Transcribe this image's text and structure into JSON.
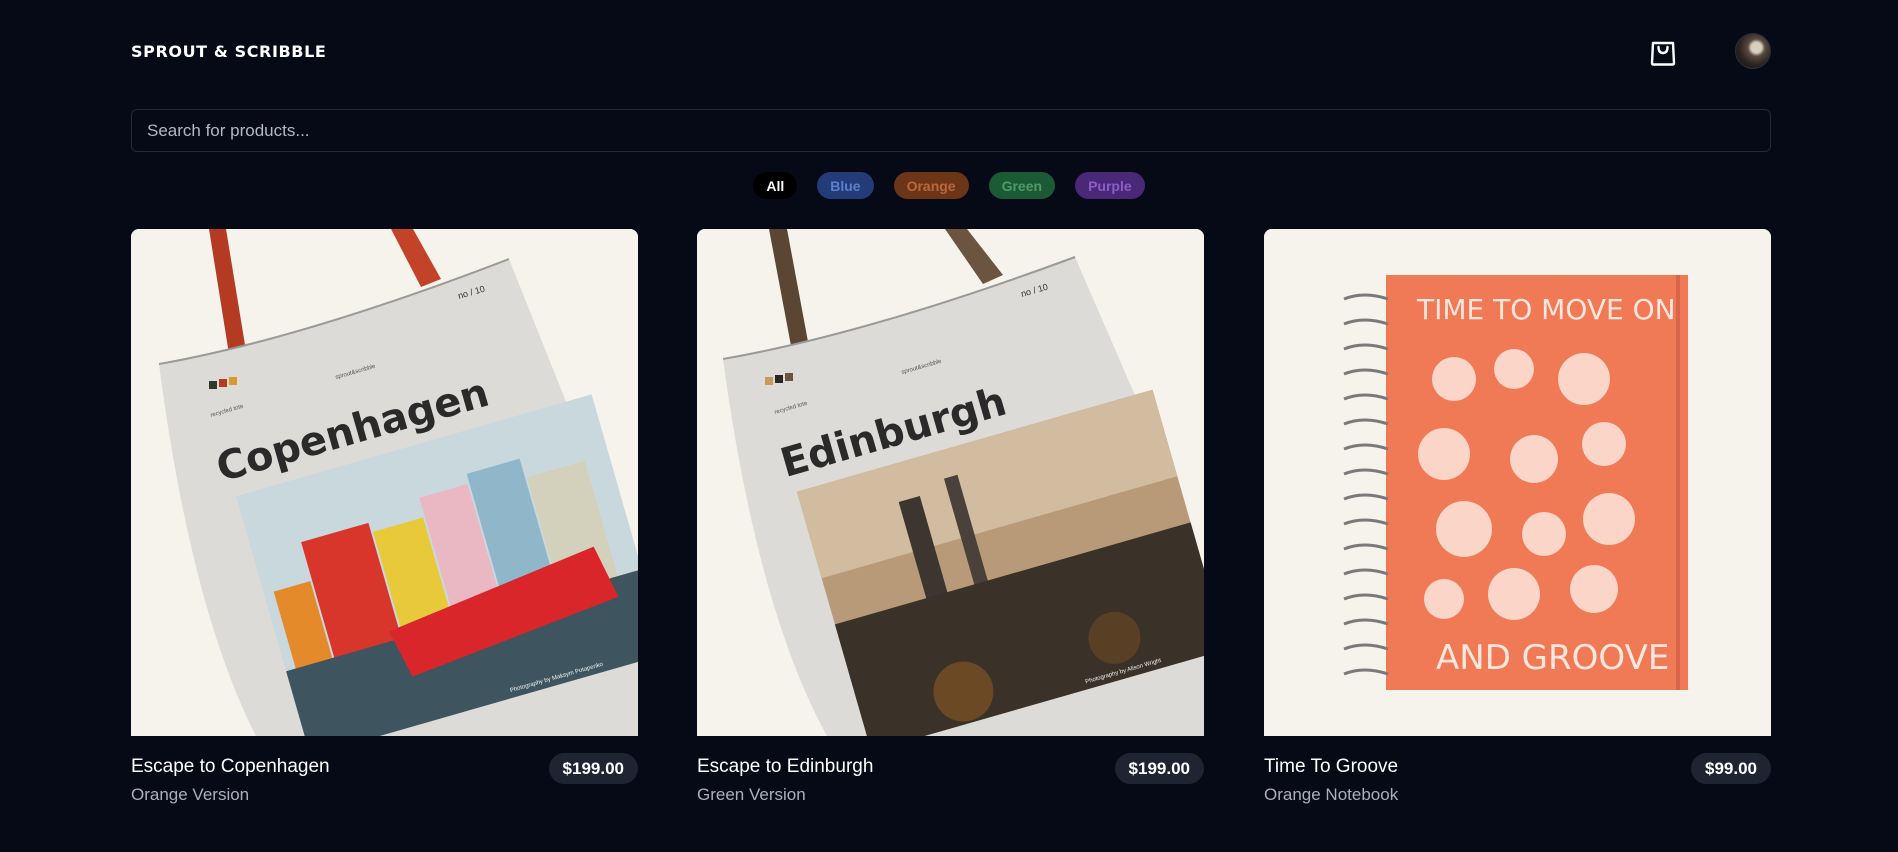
{
  "header": {
    "brand": "SPROUT & SCRIBBLE",
    "cart_icon": "shopping-bag-icon",
    "avatar": "user-avatar"
  },
  "search": {
    "placeholder": "Search for products...",
    "value": ""
  },
  "filters": [
    "All",
    "Blue",
    "Orange",
    "Green",
    "Purple"
  ],
  "products": [
    {
      "title": "Escape to Copenhagen",
      "subtitle": "Orange Version",
      "price": "$199.00",
      "image_text": "Copenhagen",
      "image_small_1": "no / 10",
      "image_small_2": "recycled tote",
      "image_small_3": "sprout&scribble",
      "image_credit": "Photography by Maksym Potapenko"
    },
    {
      "title": "Escape to Edinburgh",
      "subtitle": "Green Version",
      "price": "$199.00",
      "image_text": "Edinburgh",
      "image_small_1": "no / 10",
      "image_small_2": "recycled tote",
      "image_small_3": "sprout&scribble",
      "image_credit": "Photography by Alison Wright"
    },
    {
      "title": "Time To Groove",
      "subtitle": "Orange Notebook",
      "price": "$99.00",
      "image_text_top": "TIME TO MOVE ON",
      "image_text_bottom": "AND GROOVE"
    }
  ],
  "colors": {
    "background": "#050a16",
    "price_badge": "#1e2431",
    "notebook": "#f07a55"
  }
}
